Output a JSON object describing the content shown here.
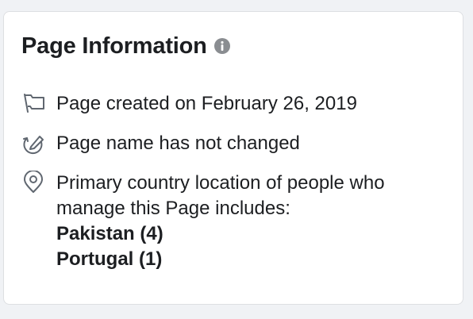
{
  "page_info": {
    "title": "Page Information",
    "created_text": "Page created on February 26, 2019",
    "name_text": "Page name has not changed",
    "location_line_1": "Primary country location of people who",
    "location_line_2": "manage this Page includes:",
    "countries": [
      "Pakistan (4)",
      "Portugal (1)"
    ]
  },
  "icons": {
    "info": "info-icon",
    "created": "flag-icon",
    "name": "edit-icon",
    "location": "location-pin-icon"
  },
  "colors": {
    "background": "#f0f2f5",
    "card": "#ffffff",
    "text": "#1c1e21",
    "icon": "#8a8d91",
    "border": "#dddfe2"
  }
}
